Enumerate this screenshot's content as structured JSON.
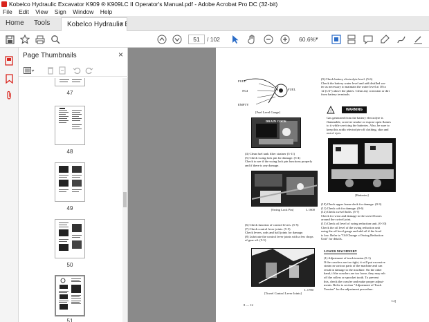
{
  "window": {
    "title": "Kobelco Hydraulic Excavator K909 ® K909LC II Operator's Manual.pdf - Adobe Acrobat Pro DC (32-bit)"
  },
  "menu": [
    "File",
    "Edit",
    "View",
    "Sign",
    "Window",
    "Help"
  ],
  "tabs": {
    "home": "Home",
    "tools": "Tools",
    "document": "Kobelco Hydraulic E...",
    "close": "×"
  },
  "toolbar": {
    "page_current": "51",
    "page_total": "/ 102",
    "zoom": "60.6%"
  },
  "panel": {
    "title": "Page Thumbnails",
    "close": "×",
    "thumbnails": [
      {
        "label": "47"
      },
      {
        "label": "48"
      },
      {
        "label": "49"
      },
      {
        "label": "50"
      },
      {
        "label": "51",
        "selected": true
      }
    ]
  },
  "document_page": {
    "gauge_labels": {
      "full": "FULL",
      "fuel": "FUEL",
      "ngi": "NGI",
      "empty": "EMPTY"
    },
    "gauge_caption": "[Fuel Level Gauge]",
    "drain_label": "DRAIN COCK",
    "items_left_1": "(4)  Clean fuel tank filter strainer (3-11)\n(5)  Check swing lock pin for damage. (5-4)\n      Check to see if the swing lock pin functions properly\n      and if there is any damage.",
    "swing_caption": "[Swing Lock Pin]",
    "swing_code": "L 1600",
    "items_left_2": "(6)  Check function of control levers. (5-5)\n(7)  Check control lever joints. (5-5)\n      Check levers, rods and ball joints for damage.\n(8)  Lubricate the control lever joints with a few drops\n      of gear oil. (5-5)",
    "travel_caption": "[Travel Control Lever Joints]",
    "travel_code": "L 1700",
    "page_number": "8 — 12",
    "items_right_1": "(9)   Check battery electrolyte level. (5-6)\n        Check the battery water level and add distilled wa-\n        ter as necessary to maintain the water level at 10 to\n        12 (1/2\") above the plates. Clean any corrosion or dirt\n        from battery terminals.",
    "warning_label": "WARNING",
    "warning_text": "Gas generated from the battery electrolyte is\nflammable, so never smoke or expose open flames\nto it while servicing the batteries. Also, be sure to\nkeep this acidic electrolyte off clothing, skin and\nout of eyes.",
    "battery_caption": "[Batteries]",
    "battery_code": "YN-0041",
    "items_right_2": "(10)  Check upper frame deck for damage. (0-3)\n(11)  Check cab for damage. (0-6)\n(12)  Check swivel bolts. (5-7)\n        Check for wear and damage to the swivel hoses\n        around the swivel joint.\n(13)  Check oil level of swing reduction unit. (0-10)\n        Check the oil level of the swing reduction unit\n        using the oil level gauge and add oil if the level\n        is low.   Refer to \"Oil Change of Swing Reduction\n        Unit\" for details.",
    "lower_heading": "LOWER MACHINERY",
    "items_right_3": "(1)  Adjustment of track tension (5-1)\n      If the crawlers are too tight, it will put excessive\n      strain on various parts of the machine and can\n      result in damage to the machine.  On the other\n      hand, if the crawlers are too loose, they may rub\n      off the rollers or sprocket tooth. To prevent\n      this, check the crawler and make proper adjust-\n      ments.  Refer to section \"Adjustment of Track\n      Tension\" for the adjustment procedure.",
    "corner_mark": "LQ"
  }
}
